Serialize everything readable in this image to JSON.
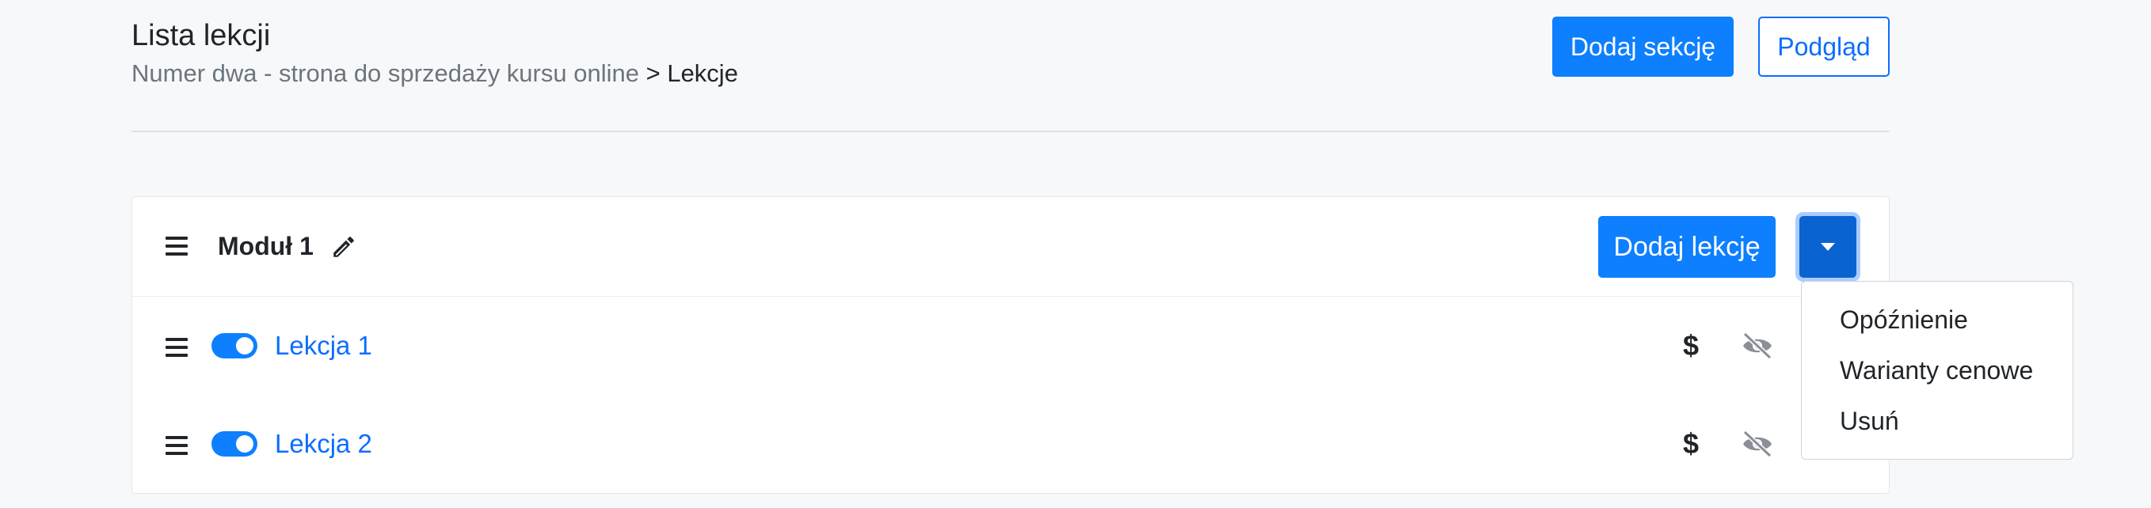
{
  "page": {
    "title": "Lista lekcji",
    "breadcrumb": {
      "parent": "Numer dwa - strona do sprzedaży kursu online",
      "separator": ">",
      "current": "Lekcje"
    }
  },
  "toolbar": {
    "add_section_label": "Dodaj sekcję",
    "preview_label": "Podgląd"
  },
  "module": {
    "title": "Moduł 1",
    "add_lesson_label": "Dodaj lekcję",
    "lessons": [
      {
        "label": "Lekcja 1",
        "enabled": true,
        "price_icon": "dollar-icon",
        "visibility_icon": "eye-slash-icon"
      },
      {
        "label": "Lekcja 2",
        "enabled": true,
        "price_icon": "dollar-icon",
        "visibility_icon": "eye-slash-icon"
      }
    ]
  },
  "dropdown_menu": {
    "items": [
      "Opóźnienie",
      "Warianty cenowe",
      "Usuń"
    ]
  },
  "icons": {
    "dollar": "$"
  },
  "colors": {
    "primary": "#0d7fff",
    "primary_active": "#0a63d1",
    "link": "#0d6efd",
    "muted_icon": "#8a8f98",
    "background": "#f7f8fa"
  }
}
